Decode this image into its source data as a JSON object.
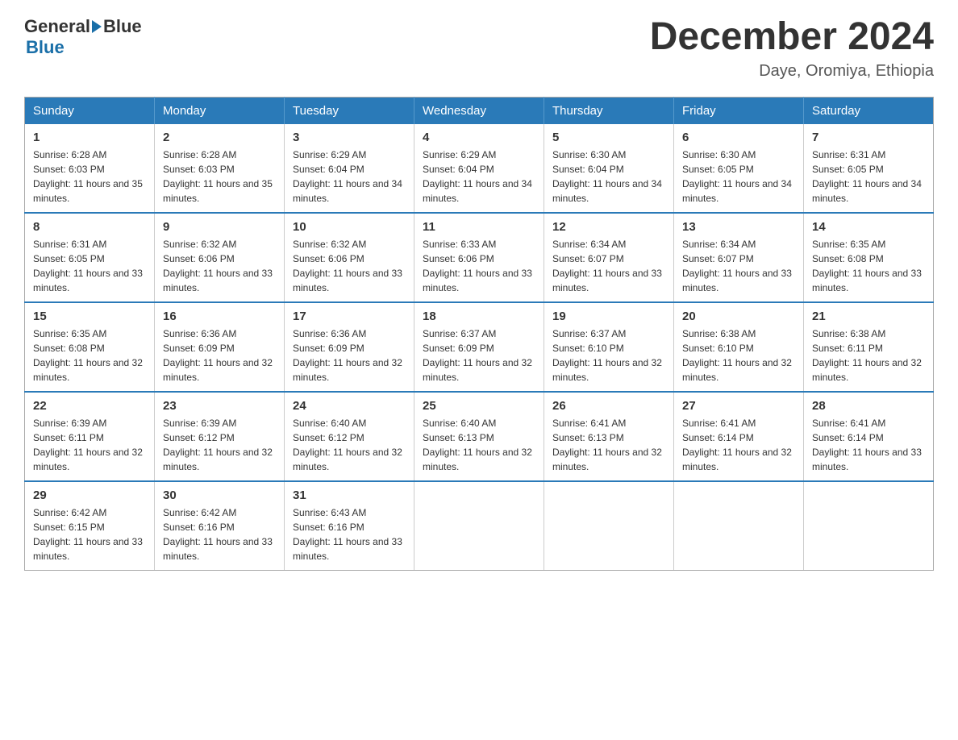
{
  "header": {
    "logo_general": "General",
    "logo_blue": "Blue",
    "month_title": "December 2024",
    "location": "Daye, Oromiya, Ethiopia"
  },
  "weekdays": [
    "Sunday",
    "Monday",
    "Tuesday",
    "Wednesday",
    "Thursday",
    "Friday",
    "Saturday"
  ],
  "weeks": [
    [
      {
        "day": "1",
        "sunrise": "6:28 AM",
        "sunset": "6:03 PM",
        "daylight": "11 hours and 35 minutes."
      },
      {
        "day": "2",
        "sunrise": "6:28 AM",
        "sunset": "6:03 PM",
        "daylight": "11 hours and 35 minutes."
      },
      {
        "day": "3",
        "sunrise": "6:29 AM",
        "sunset": "6:04 PM",
        "daylight": "11 hours and 34 minutes."
      },
      {
        "day": "4",
        "sunrise": "6:29 AM",
        "sunset": "6:04 PM",
        "daylight": "11 hours and 34 minutes."
      },
      {
        "day": "5",
        "sunrise": "6:30 AM",
        "sunset": "6:04 PM",
        "daylight": "11 hours and 34 minutes."
      },
      {
        "day": "6",
        "sunrise": "6:30 AM",
        "sunset": "6:05 PM",
        "daylight": "11 hours and 34 minutes."
      },
      {
        "day": "7",
        "sunrise": "6:31 AM",
        "sunset": "6:05 PM",
        "daylight": "11 hours and 34 minutes."
      }
    ],
    [
      {
        "day": "8",
        "sunrise": "6:31 AM",
        "sunset": "6:05 PM",
        "daylight": "11 hours and 33 minutes."
      },
      {
        "day": "9",
        "sunrise": "6:32 AM",
        "sunset": "6:06 PM",
        "daylight": "11 hours and 33 minutes."
      },
      {
        "day": "10",
        "sunrise": "6:32 AM",
        "sunset": "6:06 PM",
        "daylight": "11 hours and 33 minutes."
      },
      {
        "day": "11",
        "sunrise": "6:33 AM",
        "sunset": "6:06 PM",
        "daylight": "11 hours and 33 minutes."
      },
      {
        "day": "12",
        "sunrise": "6:34 AM",
        "sunset": "6:07 PM",
        "daylight": "11 hours and 33 minutes."
      },
      {
        "day": "13",
        "sunrise": "6:34 AM",
        "sunset": "6:07 PM",
        "daylight": "11 hours and 33 minutes."
      },
      {
        "day": "14",
        "sunrise": "6:35 AM",
        "sunset": "6:08 PM",
        "daylight": "11 hours and 33 minutes."
      }
    ],
    [
      {
        "day": "15",
        "sunrise": "6:35 AM",
        "sunset": "6:08 PM",
        "daylight": "11 hours and 32 minutes."
      },
      {
        "day": "16",
        "sunrise": "6:36 AM",
        "sunset": "6:09 PM",
        "daylight": "11 hours and 32 minutes."
      },
      {
        "day": "17",
        "sunrise": "6:36 AM",
        "sunset": "6:09 PM",
        "daylight": "11 hours and 32 minutes."
      },
      {
        "day": "18",
        "sunrise": "6:37 AM",
        "sunset": "6:09 PM",
        "daylight": "11 hours and 32 minutes."
      },
      {
        "day": "19",
        "sunrise": "6:37 AM",
        "sunset": "6:10 PM",
        "daylight": "11 hours and 32 minutes."
      },
      {
        "day": "20",
        "sunrise": "6:38 AM",
        "sunset": "6:10 PM",
        "daylight": "11 hours and 32 minutes."
      },
      {
        "day": "21",
        "sunrise": "6:38 AM",
        "sunset": "6:11 PM",
        "daylight": "11 hours and 32 minutes."
      }
    ],
    [
      {
        "day": "22",
        "sunrise": "6:39 AM",
        "sunset": "6:11 PM",
        "daylight": "11 hours and 32 minutes."
      },
      {
        "day": "23",
        "sunrise": "6:39 AM",
        "sunset": "6:12 PM",
        "daylight": "11 hours and 32 minutes."
      },
      {
        "day": "24",
        "sunrise": "6:40 AM",
        "sunset": "6:12 PM",
        "daylight": "11 hours and 32 minutes."
      },
      {
        "day": "25",
        "sunrise": "6:40 AM",
        "sunset": "6:13 PM",
        "daylight": "11 hours and 32 minutes."
      },
      {
        "day": "26",
        "sunrise": "6:41 AM",
        "sunset": "6:13 PM",
        "daylight": "11 hours and 32 minutes."
      },
      {
        "day": "27",
        "sunrise": "6:41 AM",
        "sunset": "6:14 PM",
        "daylight": "11 hours and 32 minutes."
      },
      {
        "day": "28",
        "sunrise": "6:41 AM",
        "sunset": "6:14 PM",
        "daylight": "11 hours and 33 minutes."
      }
    ],
    [
      {
        "day": "29",
        "sunrise": "6:42 AM",
        "sunset": "6:15 PM",
        "daylight": "11 hours and 33 minutes."
      },
      {
        "day": "30",
        "sunrise": "6:42 AM",
        "sunset": "6:16 PM",
        "daylight": "11 hours and 33 minutes."
      },
      {
        "day": "31",
        "sunrise": "6:43 AM",
        "sunset": "6:16 PM",
        "daylight": "11 hours and 33 minutes."
      },
      null,
      null,
      null,
      null
    ]
  ]
}
